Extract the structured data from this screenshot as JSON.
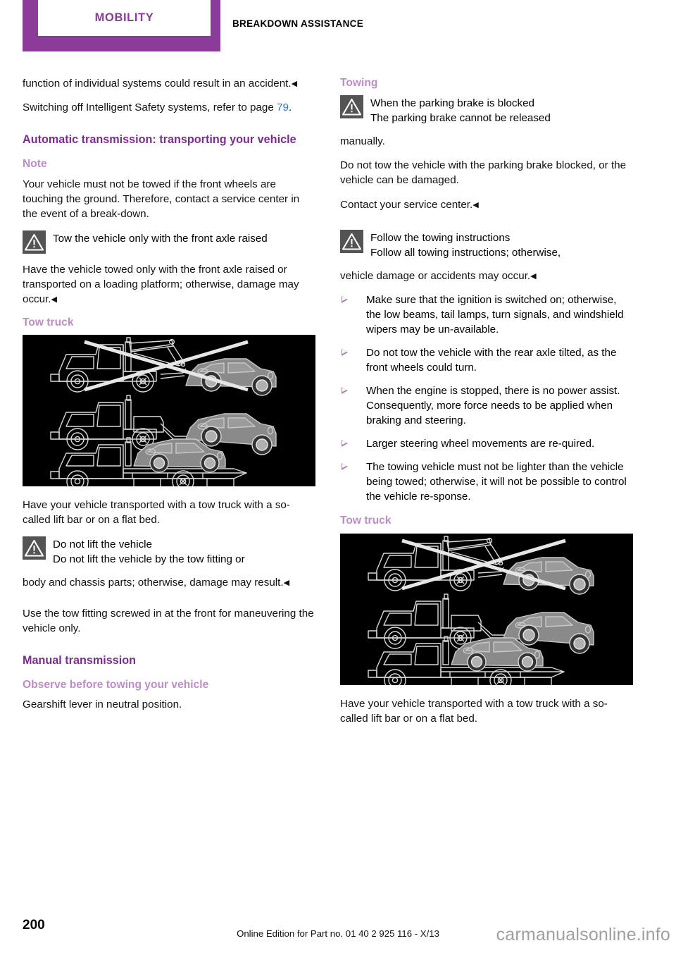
{
  "header": {
    "tab_label": "MOBILITY",
    "chapter_title": "BREAKDOWN ASSISTANCE"
  },
  "colors": {
    "tab_purple": "#8B3C9B",
    "heading_purple": "#7B2D8E",
    "subheading_mauve": "#BE8CC8",
    "bullet_marker": "#B07CC0",
    "link_blue": "#2a6ddb",
    "warning_icon_bg": "#545454",
    "figure_bg": "#000000"
  },
  "left_column": {
    "continued_paragraph": "function of individual systems could result in an accident.",
    "continued_endmark": "◀",
    "reference_prefix": "Switching off Intelligent Safety systems, refer to page ",
    "reference_page": "79",
    "reference_suffix": ".",
    "heading_automatic": "Automatic transmission: transporting your vehicle",
    "subheading_note": "Note",
    "note_text": "Your vehicle must not be towed if the front wheels are touching the ground. Therefore, contact a service center in the event of a break-down.",
    "warning_axle": {
      "icon": "warning-triangle-icon",
      "title": "Tow the vehicle only with the front axle raised",
      "body": "Have the vehicle towed only with the front axle raised or transported on a loading platform; otherwise, damage may occur.",
      "endmark": "◀"
    },
    "subheading_tow_truck": "Tow truck",
    "figure_caption": "Have your vehicle transported with a tow truck with a so-called lift bar or on a flat bed.",
    "warning_lift": {
      "icon": "warning-triangle-icon",
      "title": "Do not lift the vehicle",
      "body_lead": "Do not lift the vehicle by the tow fitting or",
      "body_rest": "body and chassis parts; otherwise, damage may result.",
      "endmark": "◀"
    },
    "tow_fitting_text": "Use the tow fitting screwed in at the front for maneuvering the vehicle only.",
    "heading_manual": "Manual transmission",
    "subheading_observe": "Observe before towing your vehicle",
    "gearshift_text": "Gearshift lever in neutral position."
  },
  "right_column": {
    "subheading_towing": "Towing",
    "warning_parking_brake": {
      "icon": "warning-triangle-icon",
      "title": "When the parking brake is blocked",
      "body_lead": "The parking brake cannot be released",
      "body_rest": "manually.",
      "para2": "Do not tow the vehicle with the parking brake blocked, or the vehicle can be damaged.",
      "para3": "Contact your service center.",
      "endmark": "◀"
    },
    "warning_instructions": {
      "icon": "warning-triangle-icon",
      "title": "Follow the towing instructions",
      "body_lead": "Follow all towing instructions; otherwise,",
      "body_rest": "vehicle damage or accidents may occur.",
      "endmark": "◀"
    },
    "bullets": [
      "Make sure that the ignition is switched on; otherwise, the low beams, tail lamps, turn signals, and windshield wipers may be un-available.",
      "Do not tow the vehicle with the rear axle tilted, as the front wheels could turn.",
      "When the engine is stopped, there is no power assist. Consequently, more force needs to be applied when braking and steering.",
      "Larger steering wheel movements are re-quired.",
      "The towing vehicle must not be lighter than the vehicle being towed; otherwise, it will not be possible to control the vehicle re-sponse."
    ],
    "subheading_tow_truck": "Tow truck",
    "figure_caption": "Have your vehicle transported with a tow truck with a so-called lift bar or on a flat bed."
  },
  "figures": {
    "tow_truck_illustration": {
      "name": "tow-truck-methods-illustration",
      "rows": [
        "lift-bar-tow-crossed-out",
        "wheel-lift-tow",
        "flat-bed-tow"
      ]
    }
  },
  "footer": {
    "page_number": "200",
    "edition_text": "Online Edition for Part no. 01 40 2 925 116 - X/13",
    "watermark": "carmanualsonline.info"
  }
}
